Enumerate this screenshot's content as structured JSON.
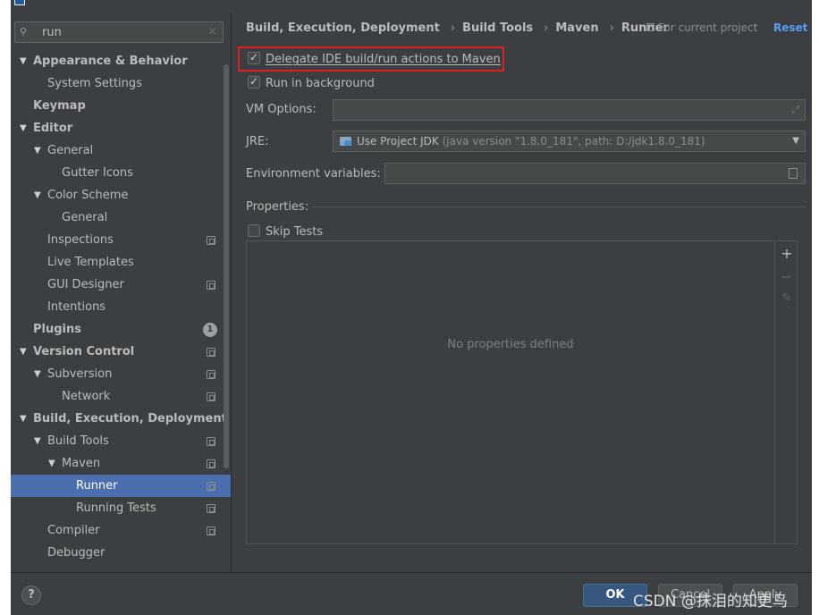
{
  "colors": {
    "selection": "#4b6eaf",
    "accent_link": "#589df6",
    "ok_button": "#365880",
    "highlight_border": "#e02020",
    "panel_bg": "#3c3f41"
  },
  "search": {
    "value": "run",
    "icon": "search-icon",
    "clear": "×"
  },
  "tree": {
    "appearance": "Appearance & Behavior",
    "system_settings": "System Settings",
    "keymap": "Keymap",
    "editor": "Editor",
    "general": "General",
    "gutter_icons": "Gutter Icons",
    "color_scheme": "Color Scheme",
    "color_general": "General",
    "inspections": "Inspections",
    "live_templates": "Live Templates",
    "gui_designer": "GUI Designer",
    "intentions": "Intentions",
    "plugins": "Plugins",
    "plugins_badge": "1",
    "version_control": "Version Control",
    "subversion": "Subversion",
    "network": "Network",
    "build": "Build, Execution, Deployment",
    "build_tools": "Build Tools",
    "maven": "Maven",
    "runner": "Runner",
    "running_tests": "Running Tests",
    "compiler": "Compiler",
    "debugger": "Debugger",
    "arrow_expanded": "▼"
  },
  "breadcrumb": {
    "p1": "Build, Execution, Deployment",
    "p2": "Build Tools",
    "p3": "Maven",
    "p4": "Runner",
    "sep": "›"
  },
  "header": {
    "for_project": "For current project",
    "reset": "Reset"
  },
  "options": {
    "delegate": "Delegate IDE build/run actions to Maven",
    "delegate_checked": true,
    "background": "Run in background",
    "background_checked": true,
    "vm_label": "VM Options:",
    "vm_value": "",
    "jre_label": "JRE:",
    "jre_main": "Use Project JDK",
    "jre_detail": "(java version \"1.8.0_181\", path: D:/jdk1.8.0_181)",
    "env_label": "Environment variables:",
    "env_value": "",
    "properties_label": "Properties:",
    "skip_tests": "Skip Tests",
    "skip_tests_checked": false,
    "no_properties": "No properties defined"
  },
  "tools": {
    "add": "+",
    "remove": "−",
    "edit": "✎"
  },
  "footer": {
    "help": "?",
    "ok": "OK",
    "cancel": "Cancel",
    "apply": "Apply",
    "watermark": "CSDN @抹泪的知更鸟"
  }
}
